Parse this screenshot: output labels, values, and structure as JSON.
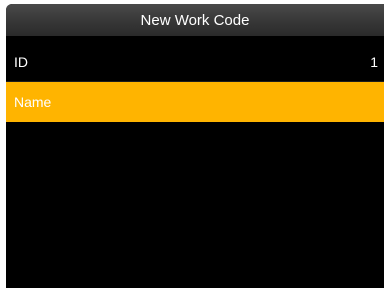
{
  "window": {
    "title": "New Work Code"
  },
  "fields": [
    {
      "label": "ID",
      "value": "1"
    },
    {
      "label": "Name",
      "value": ""
    }
  ],
  "colors": {
    "background": "#000000",
    "titlebar": "#3a3a3a",
    "highlight": "#ffb400",
    "text": "#ffffff"
  }
}
